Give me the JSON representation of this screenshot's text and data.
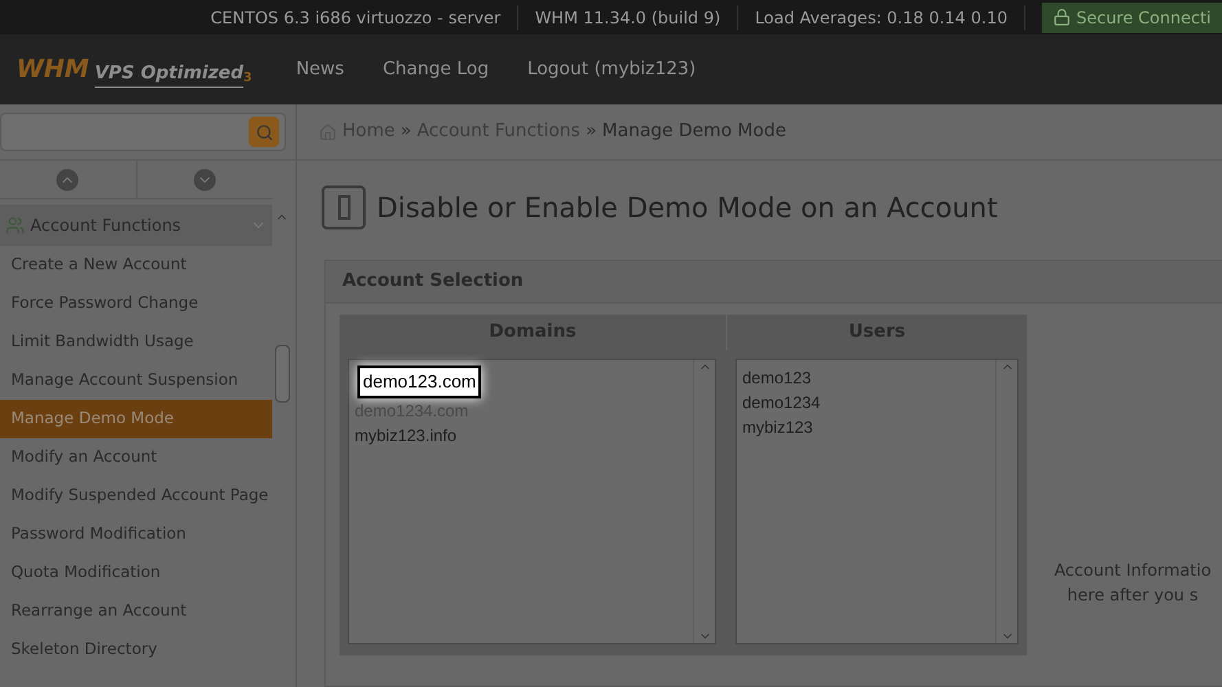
{
  "top_bar": {
    "items": [
      "CENTOS 6.3 i686 virtuozzo - server",
      "WHM 11.34.0 (build 9)",
      "Load Averages: 0.18 0.14 0.10"
    ],
    "secure": "Secure Connecti"
  },
  "header": {
    "logo_main": "WHM",
    "logo_sub": "VPS Optimized",
    "logo_ver": "3",
    "nav": [
      "News",
      "Change Log",
      "Logout (mybiz123)"
    ]
  },
  "breadcrumb_separator": "»",
  "breadcrumb": [
    {
      "label": "Home",
      "kind": "home"
    },
    {
      "label": "Account Functions",
      "kind": "link"
    },
    {
      "label": "Manage Demo Mode",
      "kind": "current"
    }
  ],
  "sidebar": {
    "section": "Account Functions",
    "items": [
      {
        "label": "Create a New Account",
        "selected": false
      },
      {
        "label": "Force Password Change",
        "selected": false
      },
      {
        "label": "Limit Bandwidth Usage",
        "selected": false
      },
      {
        "label": "Manage Account Suspension",
        "selected": false
      },
      {
        "label": "Manage Demo Mode",
        "selected": true
      },
      {
        "label": "Modify an Account",
        "selected": false
      },
      {
        "label": "Modify Suspended Account Page",
        "selected": false
      },
      {
        "label": "Password Modification",
        "selected": false
      },
      {
        "label": "Quota Modification",
        "selected": false
      },
      {
        "label": "Rearrange an Account",
        "selected": false
      },
      {
        "label": "Skeleton Directory",
        "selected": false
      }
    ]
  },
  "page_title": "Disable or Enable Demo Mode on an Account",
  "panel": {
    "title": "Account Selection",
    "domains_heading": "Domains",
    "users_heading": "Users",
    "domains": [
      {
        "label": "demo123.com",
        "highlighted": true
      },
      {
        "label": "demo1234.com",
        "highlighted": false
      },
      {
        "label": "mybiz123.info",
        "highlighted": false
      }
    ],
    "users": [
      "demo123",
      "demo1234",
      "mybiz123"
    ],
    "info_lines": [
      "Account Informatio",
      "here after you s"
    ]
  }
}
